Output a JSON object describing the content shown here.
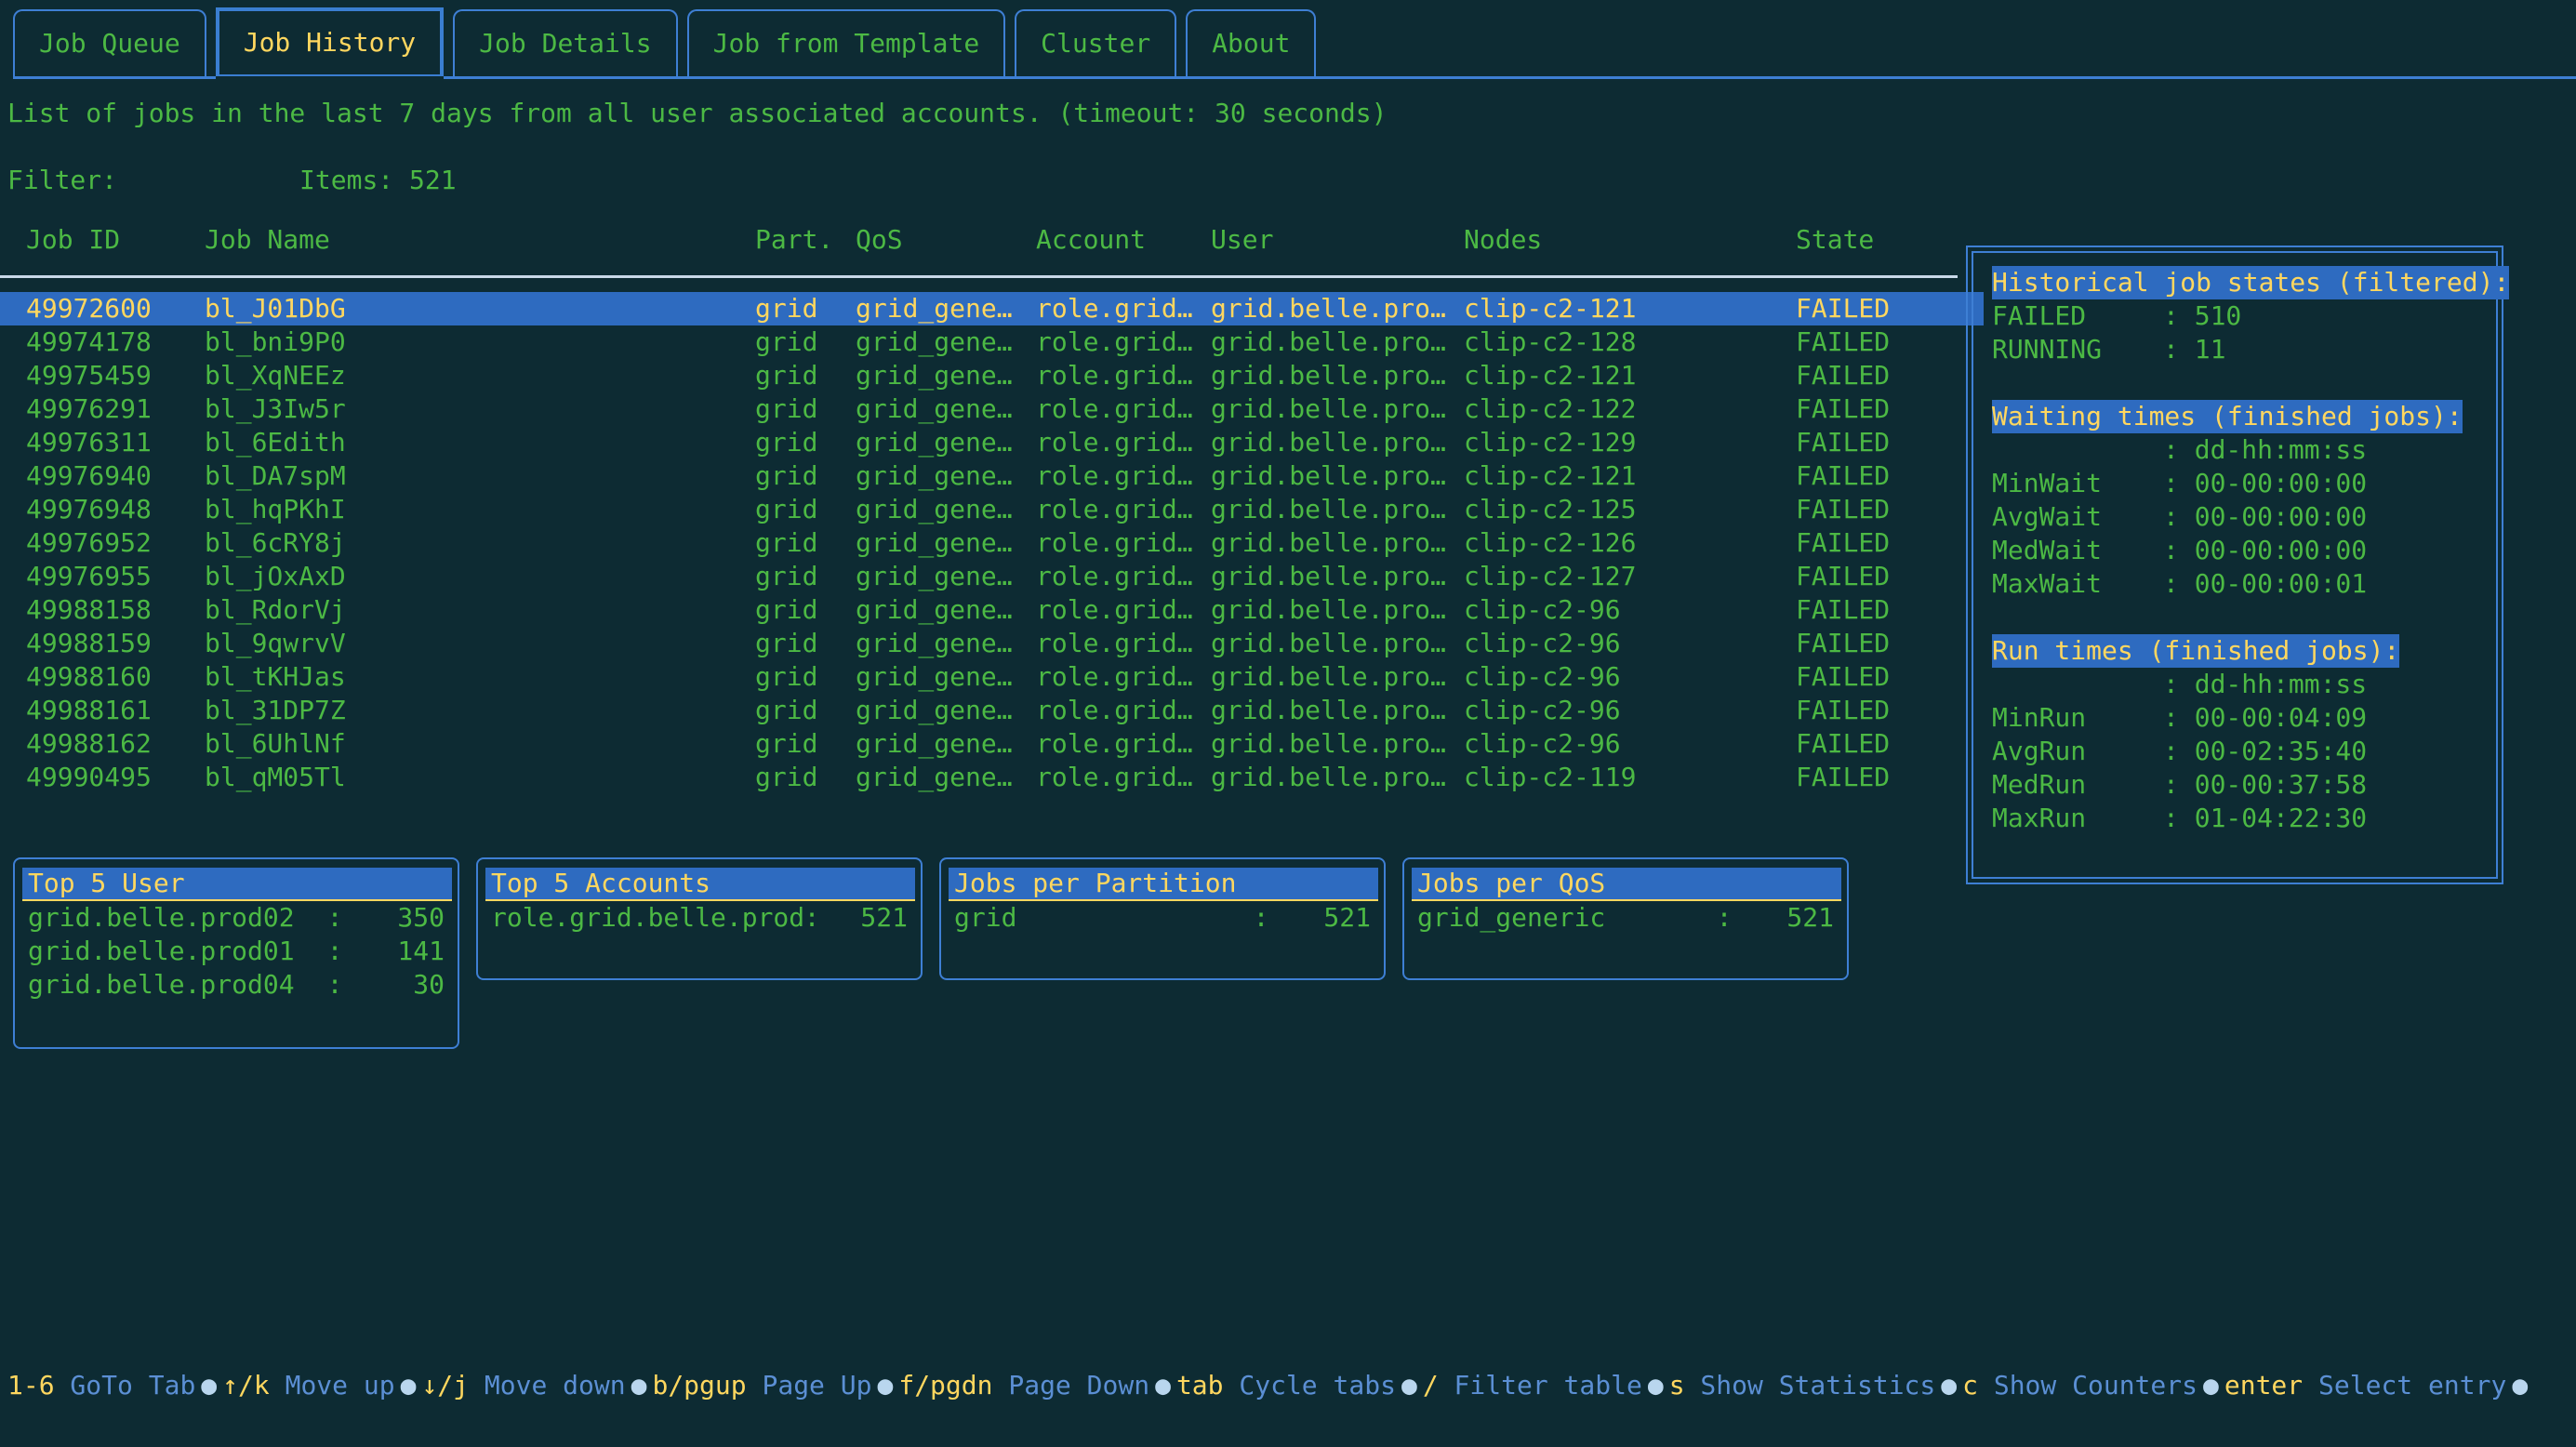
{
  "colors": {
    "background": "#0d2b33",
    "green": "#4cb944",
    "yellow": "#ffd75f",
    "blue_border": "#3e7fd4",
    "select_bg": "#2e6bc0",
    "help_desc": "#5b8fd4",
    "separator": "#c8d8e8"
  },
  "tabs": [
    {
      "label": "Job Queue",
      "active": false
    },
    {
      "label": "Job History",
      "active": true
    },
    {
      "label": "Job Details",
      "active": false
    },
    {
      "label": "Job from Template",
      "active": false
    },
    {
      "label": "Cluster",
      "active": false
    },
    {
      "label": "About",
      "active": false
    }
  ],
  "description": "List of jobs in the last 7 days from all user associated accounts. (timeout: 30 seconds)",
  "filter": {
    "label": "Filter:",
    "value": "",
    "items_label": "Items: 521"
  },
  "table": {
    "columns": [
      "Job ID",
      "Job Name",
      "Part.",
      "QoS",
      "Account",
      "User",
      "Nodes",
      "State"
    ],
    "rows": [
      {
        "jobid": "49972600",
        "name": "bl_J01DbG",
        "part": "grid",
        "qos": "grid_gene…",
        "account": "role.grid…",
        "user": "grid.belle.pro…",
        "nodes": "clip-c2-121",
        "state": "FAILED",
        "selected": true
      },
      {
        "jobid": "49974178",
        "name": "bl_bni9P0",
        "part": "grid",
        "qos": "grid_gene…",
        "account": "role.grid…",
        "user": "grid.belle.pro…",
        "nodes": "clip-c2-128",
        "state": "FAILED",
        "selected": false
      },
      {
        "jobid": "49975459",
        "name": "bl_XqNEEz",
        "part": "grid",
        "qos": "grid_gene…",
        "account": "role.grid…",
        "user": "grid.belle.pro…",
        "nodes": "clip-c2-121",
        "state": "FAILED",
        "selected": false
      },
      {
        "jobid": "49976291",
        "name": "bl_J3Iw5r",
        "part": "grid",
        "qos": "grid_gene…",
        "account": "role.grid…",
        "user": "grid.belle.pro…",
        "nodes": "clip-c2-122",
        "state": "FAILED",
        "selected": false
      },
      {
        "jobid": "49976311",
        "name": "bl_6Edith",
        "part": "grid",
        "qos": "grid_gene…",
        "account": "role.grid…",
        "user": "grid.belle.pro…",
        "nodes": "clip-c2-129",
        "state": "FAILED",
        "selected": false
      },
      {
        "jobid": "49976940",
        "name": "bl_DA7spM",
        "part": "grid",
        "qos": "grid_gene…",
        "account": "role.grid…",
        "user": "grid.belle.pro…",
        "nodes": "clip-c2-121",
        "state": "FAILED",
        "selected": false
      },
      {
        "jobid": "49976948",
        "name": "bl_hqPKhI",
        "part": "grid",
        "qos": "grid_gene…",
        "account": "role.grid…",
        "user": "grid.belle.pro…",
        "nodes": "clip-c2-125",
        "state": "FAILED",
        "selected": false
      },
      {
        "jobid": "49976952",
        "name": "bl_6cRY8j",
        "part": "grid",
        "qos": "grid_gene…",
        "account": "role.grid…",
        "user": "grid.belle.pro…",
        "nodes": "clip-c2-126",
        "state": "FAILED",
        "selected": false
      },
      {
        "jobid": "49976955",
        "name": "bl_jOxAxD",
        "part": "grid",
        "qos": "grid_gene…",
        "account": "role.grid…",
        "user": "grid.belle.pro…",
        "nodes": "clip-c2-127",
        "state": "FAILED",
        "selected": false
      },
      {
        "jobid": "49988158",
        "name": "bl_RdorVj",
        "part": "grid",
        "qos": "grid_gene…",
        "account": "role.grid…",
        "user": "grid.belle.pro…",
        "nodes": "clip-c2-96",
        "state": "FAILED",
        "selected": false
      },
      {
        "jobid": "49988159",
        "name": "bl_9qwrvV",
        "part": "grid",
        "qos": "grid_gene…",
        "account": "role.grid…",
        "user": "grid.belle.pro…",
        "nodes": "clip-c2-96",
        "state": "FAILED",
        "selected": false
      },
      {
        "jobid": "49988160",
        "name": "bl_tKHJas",
        "part": "grid",
        "qos": "grid_gene…",
        "account": "role.grid…",
        "user": "grid.belle.pro…",
        "nodes": "clip-c2-96",
        "state": "FAILED",
        "selected": false
      },
      {
        "jobid": "49988161",
        "name": "bl_31DP7Z",
        "part": "grid",
        "qos": "grid_gene…",
        "account": "role.grid…",
        "user": "grid.belle.pro…",
        "nodes": "clip-c2-96",
        "state": "FAILED",
        "selected": false
      },
      {
        "jobid": "49988162",
        "name": "bl_6UhlNf",
        "part": "grid",
        "qos": "grid_gene…",
        "account": "role.grid…",
        "user": "grid.belle.pro…",
        "nodes": "clip-c2-96",
        "state": "FAILED",
        "selected": false
      },
      {
        "jobid": "49990495",
        "name": "bl_qM05Tl",
        "part": "grid",
        "qos": "grid_gene…",
        "account": "role.grid…",
        "user": "grid.belle.pro…",
        "nodes": "clip-c2-119",
        "state": "FAILED",
        "selected": false
      }
    ]
  },
  "statistics": {
    "states": {
      "title": "Historical job states (filtered):",
      "rows": [
        {
          "key": "FAILED",
          "value": "510"
        },
        {
          "key": "RUNNING",
          "value": "11"
        }
      ]
    },
    "waiting": {
      "title": "Waiting times (finished jobs):",
      "format_row": {
        "key": "",
        "value": "dd-hh:mm:ss"
      },
      "rows": [
        {
          "key": "MinWait",
          "value": "00-00:00:00"
        },
        {
          "key": "AvgWait",
          "value": "00-00:00:00"
        },
        {
          "key": "MedWait",
          "value": "00-00:00:00"
        },
        {
          "key": "MaxWait",
          "value": "00-00:00:01"
        }
      ]
    },
    "runtimes": {
      "title": "Run times (finished jobs):",
      "format_row": {
        "key": "",
        "value": "dd-hh:mm:ss"
      },
      "rows": [
        {
          "key": "MinRun",
          "value": "00-00:04:09"
        },
        {
          "key": "AvgRun",
          "value": "00-02:35:40"
        },
        {
          "key": "MedRun",
          "value": "00-00:37:58"
        },
        {
          "key": "MaxRun",
          "value": "01-04:22:30"
        }
      ]
    }
  },
  "summary_boxes": [
    {
      "title": "Top 5 User",
      "rows": [
        {
          "label": "grid.belle.prod02",
          "value": "350"
        },
        {
          "label": "grid.belle.prod01",
          "value": "141"
        },
        {
          "label": "grid.belle.prod04",
          "value": "30"
        }
      ]
    },
    {
      "title": "Top 5 Accounts",
      "rows": [
        {
          "label": "role.grid.belle.prod",
          "value": "521"
        }
      ]
    },
    {
      "title": "Jobs per Partition",
      "rows": [
        {
          "label": "grid",
          "value": "521"
        }
      ]
    },
    {
      "title": "Jobs per QoS",
      "rows": [
        {
          "label": "grid_generic",
          "value": "521"
        }
      ]
    }
  ],
  "help_bar": {
    "separator": "●",
    "items": [
      {
        "key": "1-6",
        "desc": "GoTo Tab"
      },
      {
        "key": "↑/k",
        "desc": "Move up"
      },
      {
        "key": "↓/j",
        "desc": "Move down"
      },
      {
        "key": "b/pgup",
        "desc": "Page Up"
      },
      {
        "key": "f/pgdn",
        "desc": "Page Down"
      },
      {
        "key": "tab",
        "desc": "Cycle tabs"
      },
      {
        "key": "/",
        "desc": "Filter table"
      },
      {
        "key": "s",
        "desc": "Show Statistics"
      },
      {
        "key": "c",
        "desc": "Show Counters"
      },
      {
        "key": "enter",
        "desc": "Select entry"
      }
    ]
  }
}
